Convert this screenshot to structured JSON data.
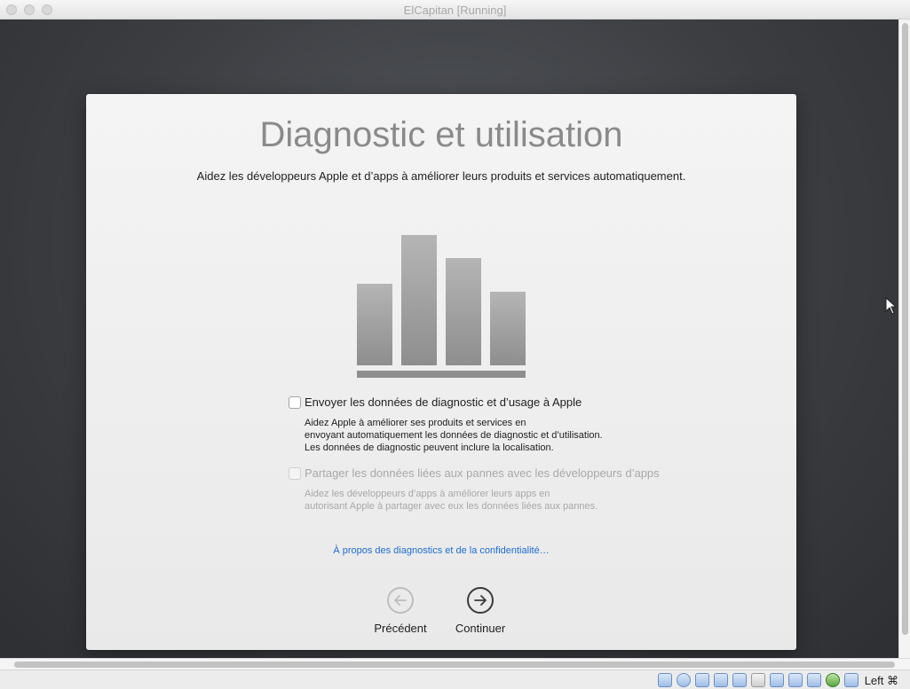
{
  "window": {
    "title": "ElCapitan [Running]"
  },
  "setup": {
    "title": "Diagnostic et utilisation",
    "subtitle": "Aidez les développeurs Apple et d’apps à améliorer leurs produits et services automatiquement.",
    "option1": {
      "label": "Envoyer les données de diagnostic et d’usage à Apple",
      "checked": false,
      "desc": [
        "Aidez Apple à améliorer ses produits et services en",
        "envoyant automatiquement les données de diagnostic et d’utilisation.",
        "Les données de diagnostic peuvent inclure la localisation."
      ]
    },
    "option2": {
      "label": "Partager les données liées aux pannes avec les développeurs d’apps",
      "checked": false,
      "enabled": false,
      "desc": [
        "Aidez les développeurs d’apps à améliorer leurs apps en",
        "autorisant Apple à partager avec eux les données liées aux pannes."
      ]
    },
    "privacy_link": "À propos des diagnostics et de la confidentialité…",
    "back_label": "Précédent",
    "continue_label": "Continuer"
  },
  "statusbar": {
    "host_key": "Left ⌘",
    "icons": [
      "hard-disk-icon",
      "optical-drive-icon",
      "audio-icon",
      "network-icon",
      "usb-icon",
      "shared-folder-icon",
      "display-icon",
      "video-capture-icon",
      "cpu-icon",
      "mouse-integration-icon",
      "download-icon"
    ]
  }
}
